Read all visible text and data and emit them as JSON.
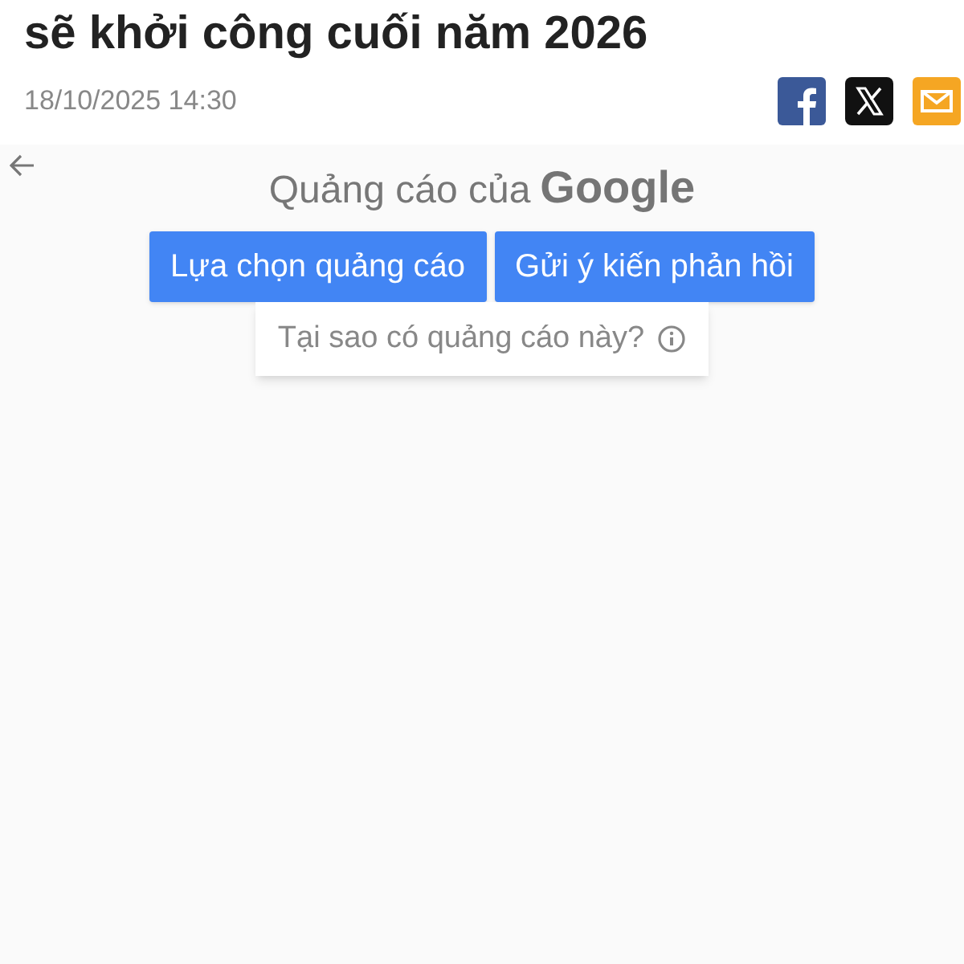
{
  "article": {
    "headline": "sẽ khởi công cuối năm 2026",
    "date": "18/10/2025 14:30"
  },
  "share": [
    {
      "kind": "facebook"
    },
    {
      "kind": "x"
    },
    {
      "kind": "email"
    }
  ],
  "ad": {
    "title": "Quảng cáo của",
    "brand": "Google",
    "buttons": [
      "Lựa chọn quảng cáo",
      "Gửi ý kiến phản hồi"
    ],
    "why": "Tại sao có quảng cáo này?"
  }
}
